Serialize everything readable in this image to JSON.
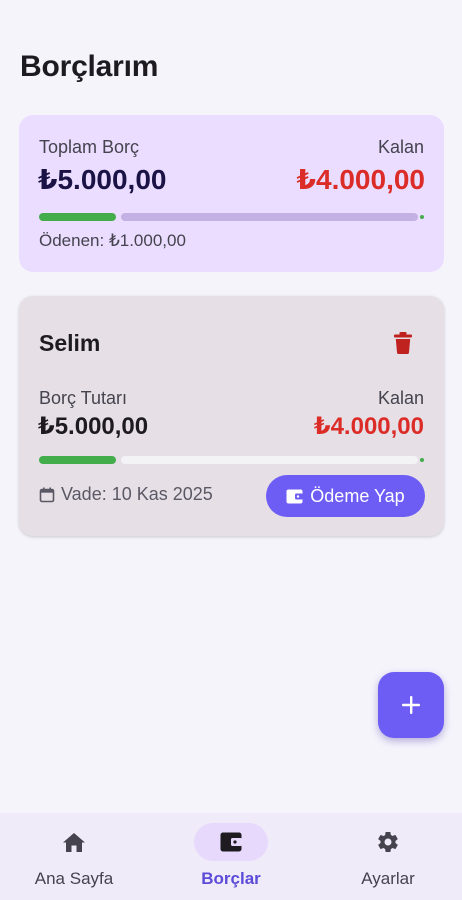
{
  "header": {
    "title": "Borçlarım"
  },
  "summary": {
    "total_label": "Toplam Borç",
    "total_value": "₺5.000,00",
    "remaining_label": "Kalan",
    "remaining_value": "₺4.000,00",
    "paid_text": "Ödenen: ₺1.000,00",
    "progress": 0.2
  },
  "debts": [
    {
      "name": "Selim",
      "amount_label": "Borç Tutarı",
      "amount_value": "₺5.000,00",
      "remaining_label": "Kalan",
      "remaining_value": "₺4.000,00",
      "progress": 0.2,
      "due_text": "Vade: 10 Kas 2025",
      "pay_button": "Ödeme Yap",
      "delete_icon": "trash-icon"
    }
  ],
  "fab": {
    "icon": "plus-icon"
  },
  "bottom_nav": {
    "items": [
      {
        "label": "Ana Sayfa",
        "icon": "home-icon",
        "active": false
      },
      {
        "label": "Borçlar",
        "icon": "wallet-icon",
        "active": true
      },
      {
        "label": "Ayarlar",
        "icon": "gear-icon",
        "active": false
      }
    ]
  },
  "colors": {
    "accent": "#6e5df5",
    "summary_bg": "#eaddff",
    "debt_card_bg": "#e6e0e6",
    "progress_fill": "#43ad4c",
    "remaining_red": "#dc2c28",
    "delete_red": "#c0221f"
  }
}
